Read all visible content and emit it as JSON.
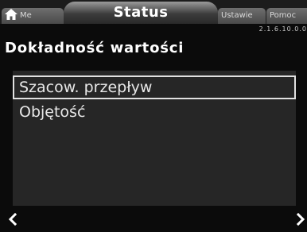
{
  "tabs": {
    "menu_label": "Me",
    "status_label": "Status",
    "settings_label": "Ustawie",
    "help_label": "Pomoc"
  },
  "header": {
    "version": "2.1.6.10.0.0",
    "title": "Dokładność wartości"
  },
  "list": {
    "items": [
      {
        "label": "Szacow. przepływ",
        "selected": true
      },
      {
        "label": "Objętość",
        "selected": false
      }
    ]
  },
  "nav": {
    "left_icon": "chevron-left-icon",
    "right_icon": "chevron-right-icon"
  }
}
